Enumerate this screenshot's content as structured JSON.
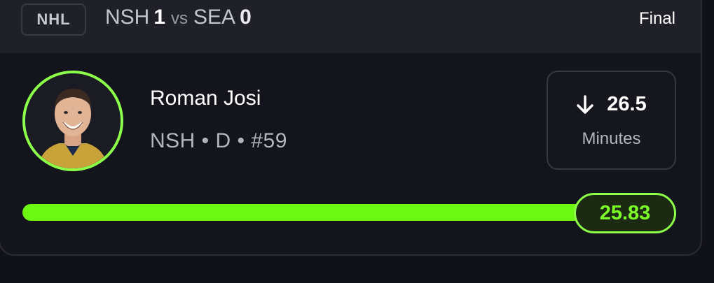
{
  "game": {
    "league": "NHL",
    "away_team": "NSH",
    "away_score": "1",
    "vs_label": "vs",
    "home_team": "SEA",
    "home_score": "0",
    "status": "Final"
  },
  "player": {
    "name": "Roman Josi",
    "meta": "NSH • D • #59",
    "avatar_icon": "player-headshot"
  },
  "line": {
    "direction_icon": "arrow-down-icon",
    "direction": "under",
    "value": "26.5",
    "stat": "Minutes"
  },
  "result": {
    "value": "25.83",
    "progress_fraction": 0.9747
  },
  "colors": {
    "accent_green": "#6cf812",
    "pill_border": "#8cff4a",
    "header_bg": "#202029",
    "card_bg": "#14141c"
  }
}
